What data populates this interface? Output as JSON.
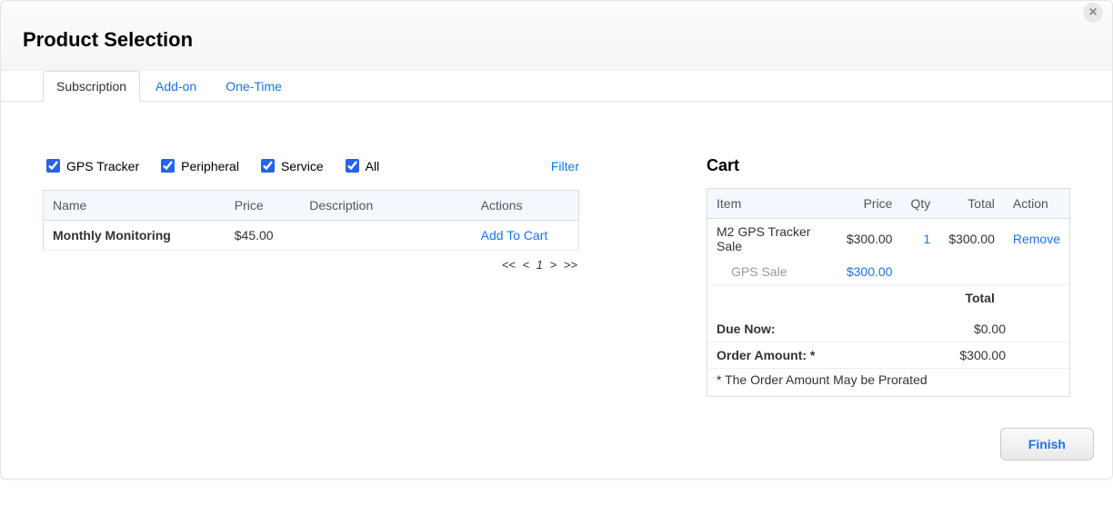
{
  "header": {
    "title": "Product Selection",
    "close_glyph": "×"
  },
  "tabs": [
    {
      "label": "Subscription",
      "active": true
    },
    {
      "label": "Add-on",
      "active": false
    },
    {
      "label": "One-Time",
      "active": false
    }
  ],
  "filters": {
    "options": [
      {
        "label": "GPS Tracker",
        "checked": true
      },
      {
        "label": "Peripheral",
        "checked": true
      },
      {
        "label": "Service",
        "checked": true
      },
      {
        "label": "All",
        "checked": true
      }
    ],
    "filter_link": "Filter"
  },
  "products": {
    "columns": [
      "Name",
      "Price",
      "Description",
      "Actions"
    ],
    "rows": [
      {
        "name": "Monthly Monitoring",
        "price": "$45.00",
        "description": "",
        "action": "Add To Cart"
      }
    ],
    "pager": {
      "first": "<<",
      "prev": "<",
      "page": "1",
      "next": ">",
      "last": ">>"
    }
  },
  "cart": {
    "title": "Cart",
    "columns": [
      "Item",
      "Price",
      "Qty",
      "Total",
      "Action"
    ],
    "rows": [
      {
        "item": "M2 GPS Tracker Sale",
        "price": "$300.00",
        "qty": "1",
        "total": "$300.00",
        "action": "Remove",
        "sub": {
          "item": "GPS Sale",
          "price": "$300.00"
        }
      }
    ],
    "total_label": "Total",
    "summary": {
      "due_now_label": "Due Now:",
      "due_now_value": "$0.00",
      "order_amount_label": "Order Amount: *",
      "order_amount_value": "$300.00"
    },
    "footnote": "* The Order Amount May be Prorated"
  },
  "footer": {
    "finish_label": "Finish"
  }
}
